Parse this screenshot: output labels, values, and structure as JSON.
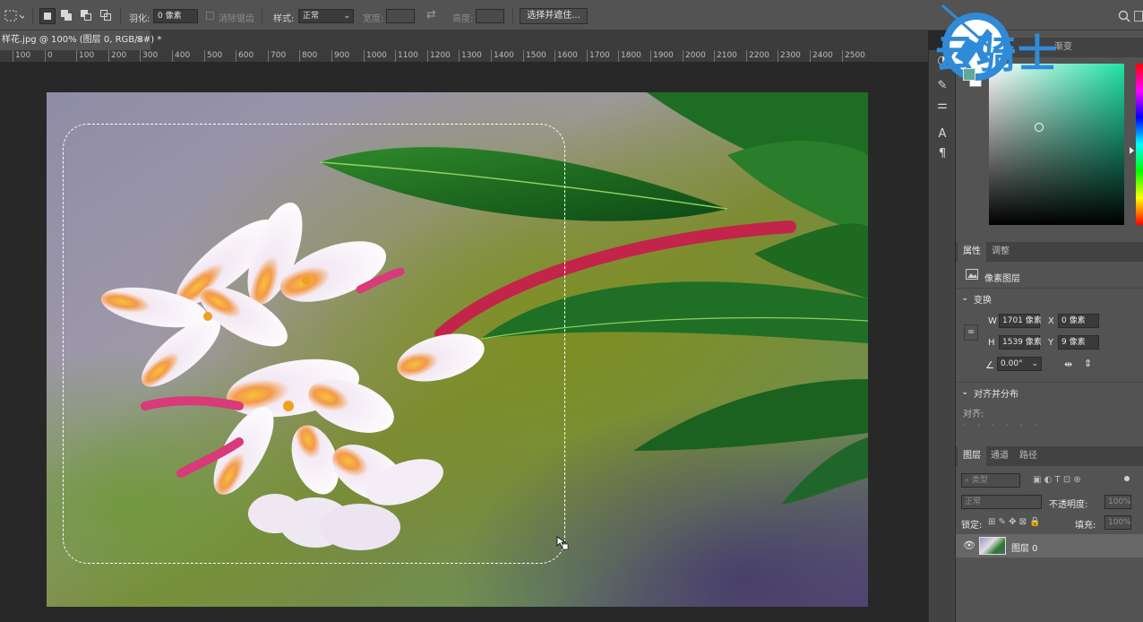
{
  "document": {
    "tab_title": "样花.jpg @ 100% (图层 0, RGB/8#) *",
    "close_symbol": "×"
  },
  "options_bar": {
    "feather_label": "羽化:",
    "feather_value": "0 像素",
    "antialias_label": "消除锯齿",
    "style_label": "样式:",
    "style_value": "正常",
    "width_label": "宽度:",
    "height_label": "高度:",
    "select_mask_button": "选择并遮住..."
  },
  "ruler": [
    "100",
    "0",
    "100",
    "200",
    "300",
    "400",
    "500",
    "600",
    "700",
    "800",
    "900",
    "1000",
    "1100",
    "1200",
    "1300",
    "1400",
    "1500",
    "1600",
    "1700",
    "1800",
    "1900",
    "2000",
    "2100",
    "2200",
    "2300",
    "2400",
    "2500"
  ],
  "color_panel": {
    "tab": "色板",
    "tab2": "渐变"
  },
  "properties": {
    "tabs": [
      "属性",
      "调整"
    ],
    "layer_type": "像素图层",
    "transform_title": "变换",
    "w_label": "W",
    "w_value": "1701 像素",
    "x_label": "X",
    "x_value": "0 像素",
    "h_label": "H",
    "h_value": "1539 像素",
    "y_label": "Y",
    "y_value": "9 像素",
    "angle_value": "0.00°",
    "align_title": "对齐并分布",
    "align_label": "对齐:"
  },
  "layers": {
    "tabs": [
      "图层",
      "通道",
      "路径"
    ],
    "search_placeholder": "类型",
    "blend_mode": "正常",
    "opacity_label": "不透明度:",
    "opacity_value": "100%",
    "lock_label": "锁定:",
    "fill_label": "填充:",
    "fill_value": "100%",
    "layer_name": "图层 0"
  },
  "watermark": {
    "text": "云骑士"
  },
  "colors": {
    "accent_teal": "#5fa89a",
    "watermark_blue": "#2f8bd8"
  }
}
